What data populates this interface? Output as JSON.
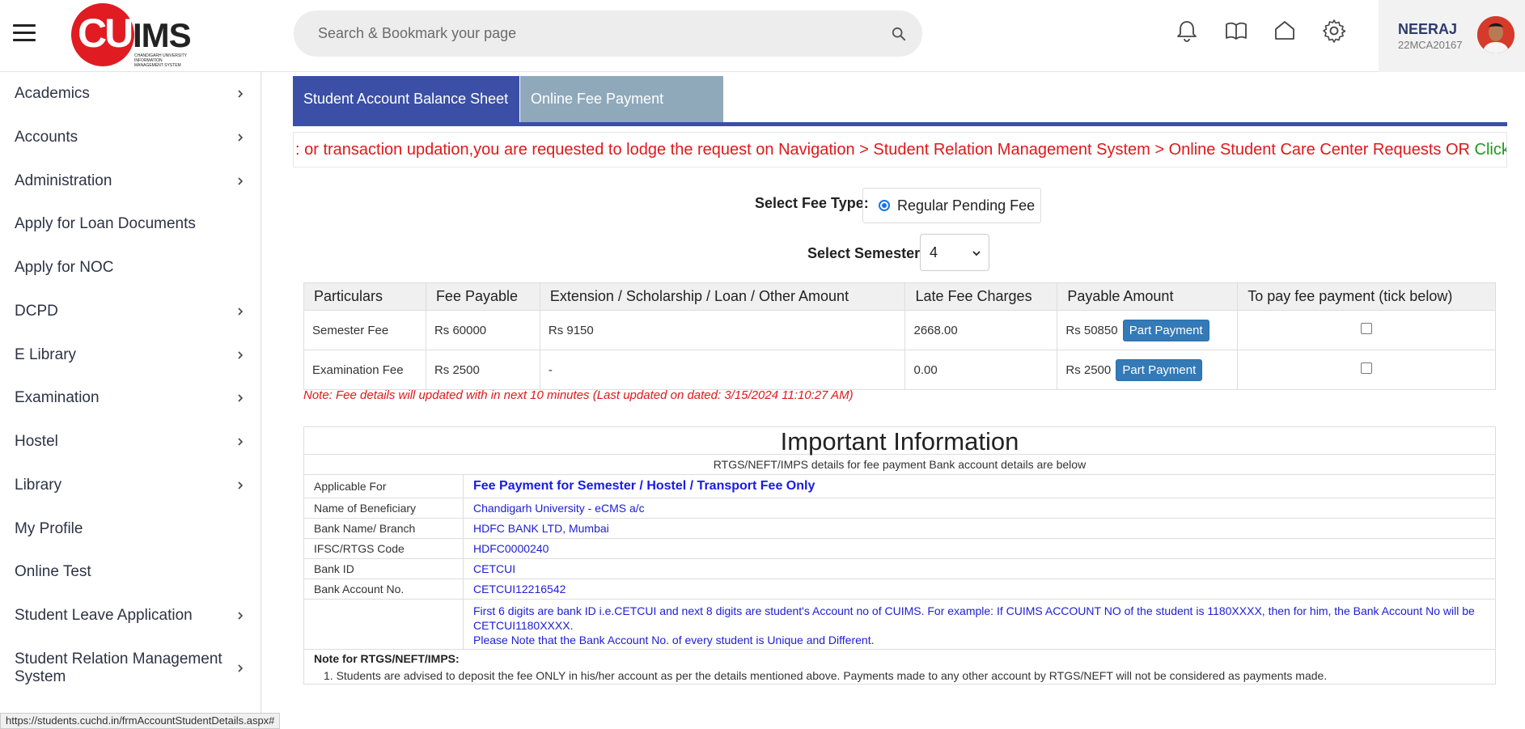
{
  "header": {
    "logo_primary": "CU",
    "logo_secondary": "IMS",
    "logo_subtitle": "CHANDIGARH UNIVERSITY INFORMATION MANAGEMENT SYSTEM",
    "search_placeholder": "Search & Bookmark your page",
    "user_name": "NEERAJ",
    "user_id": "22MCA20167"
  },
  "sidebar": {
    "items": [
      {
        "label": "Academics",
        "has_children": true
      },
      {
        "label": "Accounts",
        "has_children": true
      },
      {
        "label": "Administration",
        "has_children": true
      },
      {
        "label": "Apply for Loan Documents",
        "has_children": false
      },
      {
        "label": "Apply for NOC",
        "has_children": false
      },
      {
        "label": "DCPD",
        "has_children": true
      },
      {
        "label": "E Library",
        "has_children": true
      },
      {
        "label": "Examination",
        "has_children": true
      },
      {
        "label": "Hostel",
        "has_children": true
      },
      {
        "label": "Library",
        "has_children": true
      },
      {
        "label": "My Profile",
        "has_children": false
      },
      {
        "label": "Online Test",
        "has_children": false
      },
      {
        "label": "Student Leave Application",
        "has_children": true
      },
      {
        "label": "Student Relation Management System",
        "has_children": true
      }
    ]
  },
  "tabs": [
    {
      "label": "Student Account Balance Sheet",
      "active": true
    },
    {
      "label": "Online Fee Payment History",
      "active": false
    }
  ],
  "marquee": {
    "text": ": or transaction updation,you are requested to lodge the request on Navigation > Student Relation Management System > Online Student Care Center Requests OR ",
    "link": "Click"
  },
  "form": {
    "fee_type_label": "Select Fee Type:",
    "fee_type_option": "Regular Pending Fee",
    "semester_label": "Select Semester:",
    "semester_value": "4"
  },
  "fee_table": {
    "headers": [
      "Particulars",
      "Fee Payable",
      "Extension / Scholarship / Loan / Other Amount",
      "Late Fee Charges",
      "Payable Amount",
      "To pay fee payment (tick below)"
    ],
    "rows": [
      {
        "particulars": "Semester Fee",
        "fee_payable": "Rs 60000",
        "extension": "Rs 9150",
        "late_fee": "2668.00",
        "payable_amount": "Rs 50850",
        "button": "Part Payment"
      },
      {
        "particulars": "Examination Fee",
        "fee_payable": "Rs 2500",
        "extension": "-",
        "late_fee": "0.00",
        "payable_amount": "Rs 2500",
        "button": "Part Payment"
      }
    ]
  },
  "note": "Note: Fee details will updated with in next 10 minutes (Last updated on dated: 3/15/2024 11:10:27 AM)",
  "info": {
    "title": "Important Information",
    "subtitle": "RTGS/NEFT/IMPS details for fee payment Bank account details are below",
    "rows": [
      {
        "key": "Applicable For",
        "value": "Fee Payment for Semester / Hostel / Transport Fee Only"
      },
      {
        "key": "Name of Beneficiary",
        "value": "Chandigarh University - eCMS a/c"
      },
      {
        "key": "Bank Name/ Branch",
        "value": "HDFC BANK LTD, Mumbai"
      },
      {
        "key": "IFSC/RTGS Code",
        "value": "HDFC0000240"
      },
      {
        "key": "Bank ID",
        "value": "CETCUI"
      },
      {
        "key": "Bank Account No.",
        "value": "CETCUI12216542"
      }
    ],
    "explain_1": "First 6 digits are bank ID i.e.CETCUI and next 8 digits are student's Account no of CUIMS. For example: If CUIMS ACCOUNT NO of the student is 1180XXXX, then for him, the Bank Account No will be CETCUI1180XXXX.",
    "explain_2": "Please Note that the Bank Account No. of every student is Unique and Different.",
    "note_title": "Note for RTGS/NEFT/IMPS:",
    "note_text": "1. Students are advised to deposit the fee ONLY in his/her account as per the details mentioned above. Payments made to any other account by RTGS/NEFT will not be considered as payments made."
  },
  "statusbar": "https://students.cuchd.in/frmAccountStudentDetails.aspx#",
  "colors": {
    "brand_red": "#e11b22",
    "tab_active": "#3b4fa6",
    "tab_inactive": "#8fa9bb",
    "marquee_red": "#e0181b",
    "link_green": "#1b9b1b",
    "info_blue": "#1d1dd6",
    "button_blue": "#337ab7"
  },
  "icons": [
    "menu-icon",
    "search-icon",
    "bell-icon",
    "book-icon",
    "home-icon",
    "gear-icon",
    "chevron-right-icon",
    "chevron-down-icon"
  ]
}
